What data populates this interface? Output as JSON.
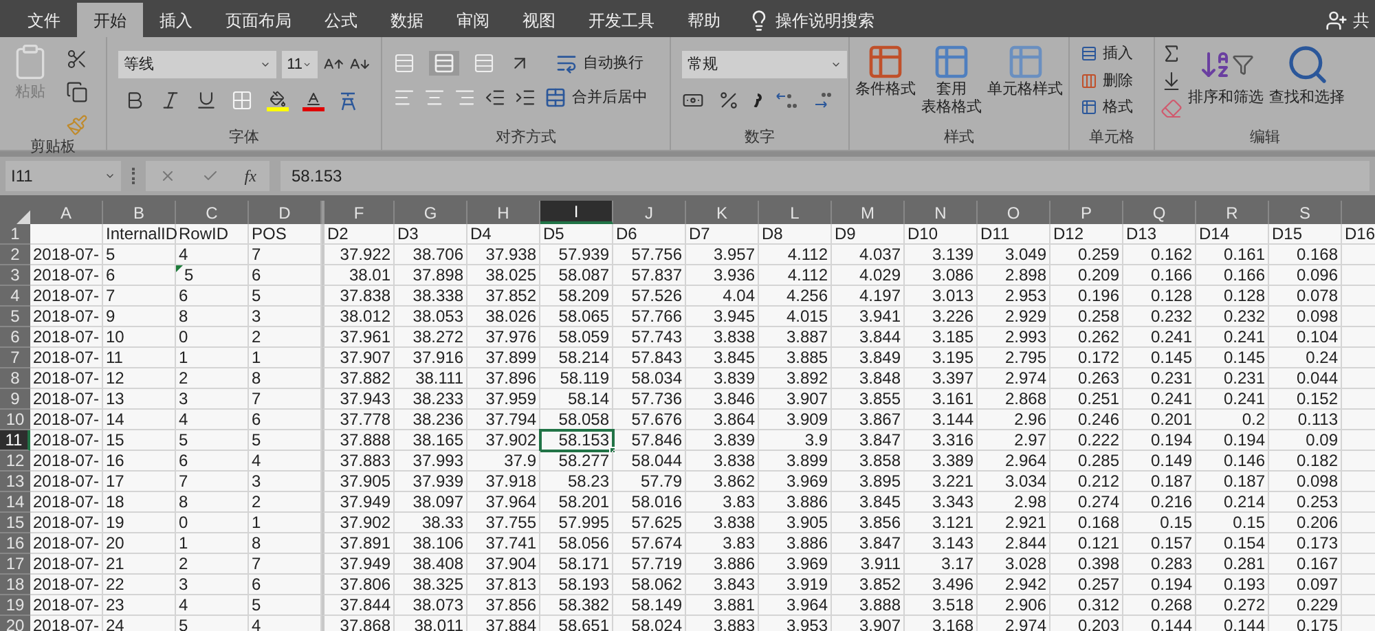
{
  "tabs": [
    {
      "label": "文件",
      "selected": false
    },
    {
      "label": "开始",
      "selected": true
    },
    {
      "label": "插入",
      "selected": false
    },
    {
      "label": "页面布局",
      "selected": false
    },
    {
      "label": "公式",
      "selected": false
    },
    {
      "label": "数据",
      "selected": false
    },
    {
      "label": "审阅",
      "selected": false
    },
    {
      "label": "视图",
      "selected": false
    },
    {
      "label": "开发工具",
      "selected": false
    },
    {
      "label": "帮助",
      "selected": false
    }
  ],
  "tell_me": "操作说明搜索",
  "share": "共",
  "clipboard": {
    "label": "剪贴板",
    "paste": "粘贴"
  },
  "font": {
    "label": "字体",
    "name": "等线",
    "size": "11"
  },
  "alignment": {
    "label": "对齐方式",
    "wrap": "自动换行",
    "merge": "合并后居中"
  },
  "number": {
    "label": "数字",
    "format": "常规"
  },
  "styles": {
    "label": "样式",
    "buttons": [
      [
        "条件格式"
      ],
      [
        "套用",
        "表格格式"
      ],
      [
        "单元格样式"
      ]
    ]
  },
  "cells": {
    "label": "单元格",
    "buttons": [
      "插入",
      "删除",
      "格式"
    ]
  },
  "editing": {
    "label": "编辑",
    "buttons": [
      "排序和筛选",
      "查找和选择"
    ]
  },
  "formula_bar": {
    "name_box": "I11",
    "fx": "fx",
    "value": "58.153"
  },
  "columns": [
    {
      "letter": "A",
      "kind": "text",
      "selected": false
    },
    {
      "letter": "B",
      "kind": "text",
      "selected": false
    },
    {
      "letter": "C",
      "kind": "text",
      "selected": false
    },
    {
      "letter": "D",
      "kind": "text",
      "selected": false
    },
    {
      "letter": "F",
      "kind": "number",
      "selected": false
    },
    {
      "letter": "G",
      "kind": "number",
      "selected": false
    },
    {
      "letter": "H",
      "kind": "number",
      "selected": false
    },
    {
      "letter": "I",
      "kind": "number",
      "selected": true
    },
    {
      "letter": "J",
      "kind": "number",
      "selected": false
    },
    {
      "letter": "K",
      "kind": "number",
      "selected": false
    },
    {
      "letter": "L",
      "kind": "number",
      "selected": false
    },
    {
      "letter": "M",
      "kind": "number",
      "selected": false
    },
    {
      "letter": "N",
      "kind": "number",
      "selected": false
    },
    {
      "letter": "O",
      "kind": "number",
      "selected": false
    },
    {
      "letter": "P",
      "kind": "number",
      "selected": false
    },
    {
      "letter": "Q",
      "kind": "number",
      "selected": false
    },
    {
      "letter": "R",
      "kind": "number",
      "selected": false
    },
    {
      "letter": "S",
      "kind": "number",
      "selected": false
    },
    {
      "kind": "number"
    }
  ],
  "rows": [
    {
      "header": "1",
      "selected": false,
      "cells": [
        null,
        "InternalID",
        "RowID",
        "POS",
        "D2",
        "D3",
        "D4",
        "D5",
        "D6",
        "D7",
        "D8",
        "D9",
        "D10",
        "D11",
        "D12",
        "D13",
        "D14",
        "D15",
        "D16"
      ]
    },
    {
      "header": "2",
      "selected": false,
      "cells": [
        "2018-07-",
        "5",
        "4",
        "7",
        "37.922",
        "38.706",
        "37.938",
        "57.939",
        "57.756",
        "3.957",
        "4.112",
        "4.037",
        "3.139",
        "3.049",
        "0.259",
        "0.162",
        "0.161",
        "0.168"
      ]
    },
    {
      "header": "3",
      "selected": false,
      "cells": [
        "2018-07-",
        "6",
        {
          "text": "5",
          "flagged": true
        },
        "6",
        "38.01",
        "37.898",
        "38.025",
        "58.087",
        "57.837",
        "3.936",
        "4.112",
        "4.029",
        "3.086",
        "2.898",
        "0.209",
        "0.166",
        "0.166",
        "0.096"
      ]
    },
    {
      "header": "4",
      "selected": false,
      "cells": [
        "2018-07-",
        "7",
        "6",
        "5",
        "37.838",
        "38.338",
        "37.852",
        "58.209",
        "57.526",
        "4.04",
        "4.256",
        "4.197",
        "3.013",
        "2.953",
        "0.196",
        "0.128",
        "0.128",
        "0.078"
      ]
    },
    {
      "header": "5",
      "selected": false,
      "cells": [
        "2018-07-",
        "9",
        "8",
        "3",
        "38.012",
        "38.053",
        "38.026",
        "58.065",
        "57.766",
        "3.945",
        "4.015",
        "3.941",
        "3.226",
        "2.929",
        "0.258",
        "0.232",
        "0.232",
        "0.098"
      ]
    },
    {
      "header": "6",
      "selected": false,
      "cells": [
        "2018-07-",
        "10",
        "0",
        "2",
        "37.961",
        "38.272",
        "37.976",
        "58.059",
        "57.743",
        "3.838",
        "3.887",
        "3.844",
        "3.185",
        "2.993",
        "0.262",
        "0.241",
        "0.241",
        "0.104"
      ]
    },
    {
      "header": "7",
      "selected": false,
      "cells": [
        "2018-07-",
        "11",
        "1",
        "1",
        "37.907",
        "37.916",
        "37.899",
        "58.214",
        "57.843",
        "3.845",
        "3.885",
        "3.849",
        "3.195",
        "2.795",
        "0.172",
        "0.145",
        "0.145",
        "0.24"
      ]
    },
    {
      "header": "8",
      "selected": false,
      "cells": [
        "2018-07-",
        "12",
        "2",
        "8",
        "37.882",
        "38.111",
        "37.896",
        "58.119",
        "58.034",
        "3.839",
        "3.892",
        "3.848",
        "3.397",
        "2.974",
        "0.263",
        "0.231",
        "0.231",
        "0.044"
      ]
    },
    {
      "header": "9",
      "selected": false,
      "cells": [
        "2018-07-",
        "13",
        "3",
        "7",
        "37.943",
        "38.233",
        "37.959",
        "58.14",
        "57.736",
        "3.846",
        "3.907",
        "3.855",
        "3.161",
        "2.868",
        "0.251",
        "0.241",
        "0.241",
        "0.152"
      ]
    },
    {
      "header": "10",
      "selected": false,
      "cells": [
        "2018-07-",
        "14",
        "4",
        "6",
        "37.778",
        "38.236",
        "37.794",
        "58.058",
        "57.676",
        "3.864",
        "3.909",
        "3.867",
        "3.144",
        "2.96",
        "0.246",
        "0.201",
        "0.2",
        "0.113"
      ]
    },
    {
      "header": "11",
      "selected": true,
      "cells": [
        "2018-07-",
        "15",
        "5",
        "5",
        "37.888",
        "38.165",
        "37.902",
        "58.153",
        "57.846",
        "3.839",
        "3.9",
        "3.847",
        "3.316",
        "2.97",
        "0.222",
        "0.194",
        "0.194",
        "0.09"
      ]
    },
    {
      "header": "12",
      "selected": false,
      "cells": [
        "2018-07-",
        "16",
        "6",
        "4",
        "37.883",
        "37.993",
        "37.9",
        "58.277",
        "58.044",
        "3.838",
        "3.899",
        "3.858",
        "3.389",
        "2.964",
        "0.285",
        "0.149",
        "0.146",
        "0.182"
      ]
    },
    {
      "header": "13",
      "selected": false,
      "cells": [
        "2018-07-",
        "17",
        "7",
        "3",
        "37.905",
        "37.939",
        "37.918",
        "58.23",
        "57.79",
        "3.862",
        "3.969",
        "3.895",
        "3.221",
        "3.034",
        "0.212",
        "0.187",
        "0.187",
        "0.098"
      ]
    },
    {
      "header": "14",
      "selected": false,
      "cells": [
        "2018-07-",
        "18",
        "8",
        "2",
        "37.949",
        "38.097",
        "37.964",
        "58.201",
        "58.016",
        "3.83",
        "3.886",
        "3.845",
        "3.343",
        "2.98",
        "0.274",
        "0.216",
        "0.214",
        "0.253"
      ]
    },
    {
      "header": "15",
      "selected": false,
      "cells": [
        "2018-07-",
        "19",
        "0",
        "1",
        "37.902",
        "38.33",
        "37.755",
        "57.995",
        "57.625",
        "3.838",
        "3.905",
        "3.856",
        "3.121",
        "2.921",
        "0.168",
        "0.15",
        "0.15",
        "0.206"
      ]
    },
    {
      "header": "16",
      "selected": false,
      "cells": [
        "2018-07-",
        "20",
        "1",
        "8",
        "37.891",
        "38.106",
        "37.741",
        "58.056",
        "57.674",
        "3.83",
        "3.886",
        "3.847",
        "3.143",
        "2.844",
        "0.121",
        "0.157",
        "0.154",
        "0.173"
      ]
    },
    {
      "header": "17",
      "selected": false,
      "cells": [
        "2018-07-",
        "21",
        "2",
        "7",
        "37.949",
        "38.408",
        "37.904",
        "58.171",
        "57.719",
        "3.886",
        "3.969",
        "3.911",
        "3.17",
        "3.028",
        "0.398",
        "0.283",
        "0.281",
        "0.167"
      ]
    },
    {
      "header": "18",
      "selected": false,
      "cells": [
        "2018-07-",
        "22",
        "3",
        "6",
        "37.806",
        "38.325",
        "37.813",
        "58.193",
        "58.062",
        "3.843",
        "3.919",
        "3.852",
        "3.496",
        "2.942",
        "0.257",
        "0.194",
        "0.193",
        "0.097"
      ]
    },
    {
      "header": "19",
      "selected": false,
      "cells": [
        "2018-07-",
        "23",
        "4",
        "5",
        "37.844",
        "38.073",
        "37.856",
        "58.382",
        "58.149",
        "3.881",
        "3.964",
        "3.888",
        "3.518",
        "2.906",
        "0.312",
        "0.268",
        "0.272",
        "0.229"
      ]
    },
    {
      "header": "20",
      "selected": false,
      "cells": [
        "2018-07-",
        "24",
        "5",
        "4",
        "37.868",
        "38.011",
        "37.884",
        "58.651",
        "58.024",
        "3.883",
        "3.953",
        "3.907",
        "3.168",
        "2.974",
        "0.203",
        "0.144",
        "0.144",
        "0.175"
      ]
    }
  ]
}
